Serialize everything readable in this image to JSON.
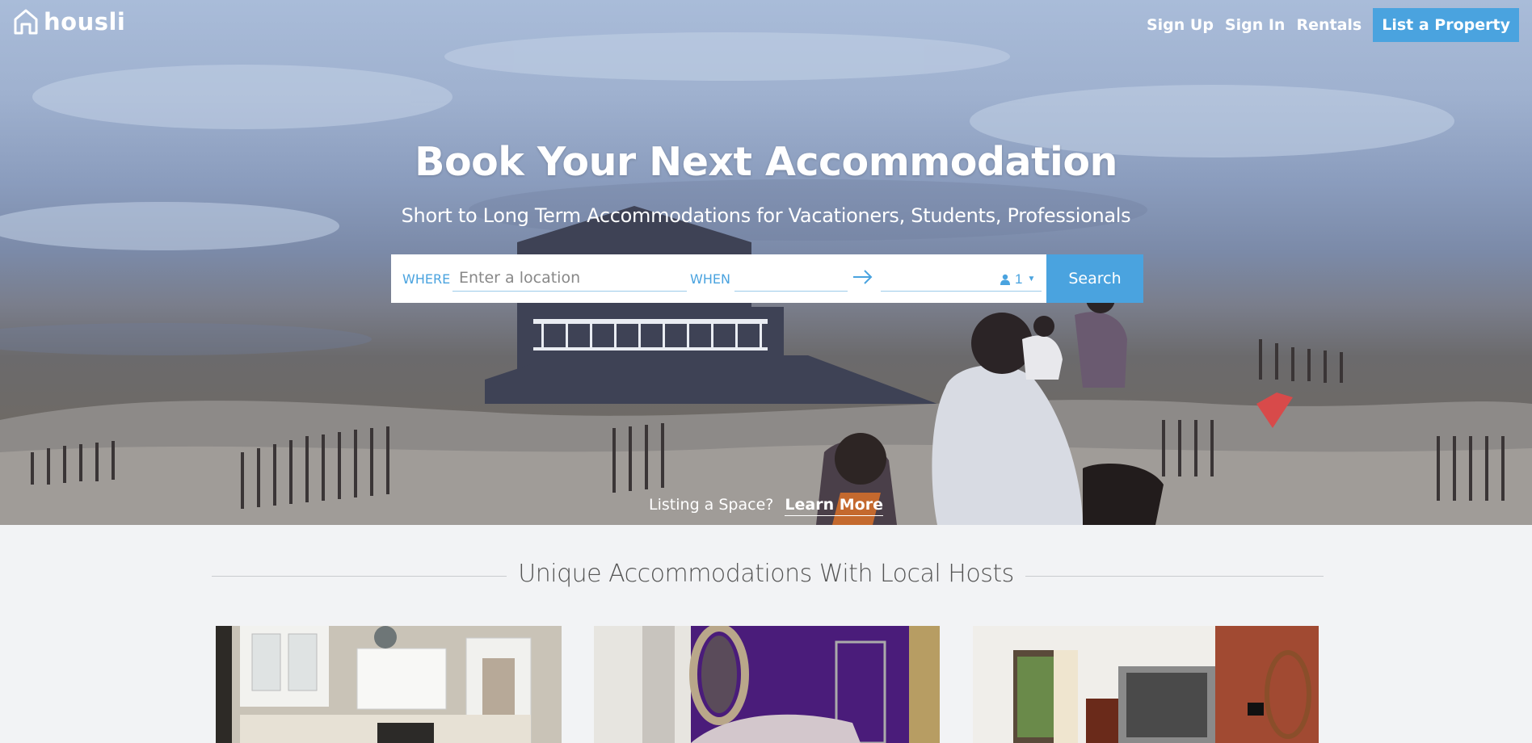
{
  "brand": {
    "name": "housli",
    "accent": "#4aa3df"
  },
  "nav": {
    "sign_up": "Sign Up",
    "sign_in": "Sign In",
    "rentals": "Rentals",
    "list_property": "List a Property"
  },
  "hero": {
    "title": "Book Your Next Accommodation",
    "subtitle": "Short to Long Term Accommodations for Vacationers, Students, Professionals"
  },
  "search": {
    "where_label": "WHERE",
    "where_placeholder": "Enter a location",
    "when_label": "WHEN",
    "guests_count": "1",
    "button_label": "Search"
  },
  "listing": {
    "prompt": "Listing a Space?",
    "learn_more": "Learn More"
  },
  "section": {
    "title": "Unique Accommodations With Local Hosts"
  }
}
